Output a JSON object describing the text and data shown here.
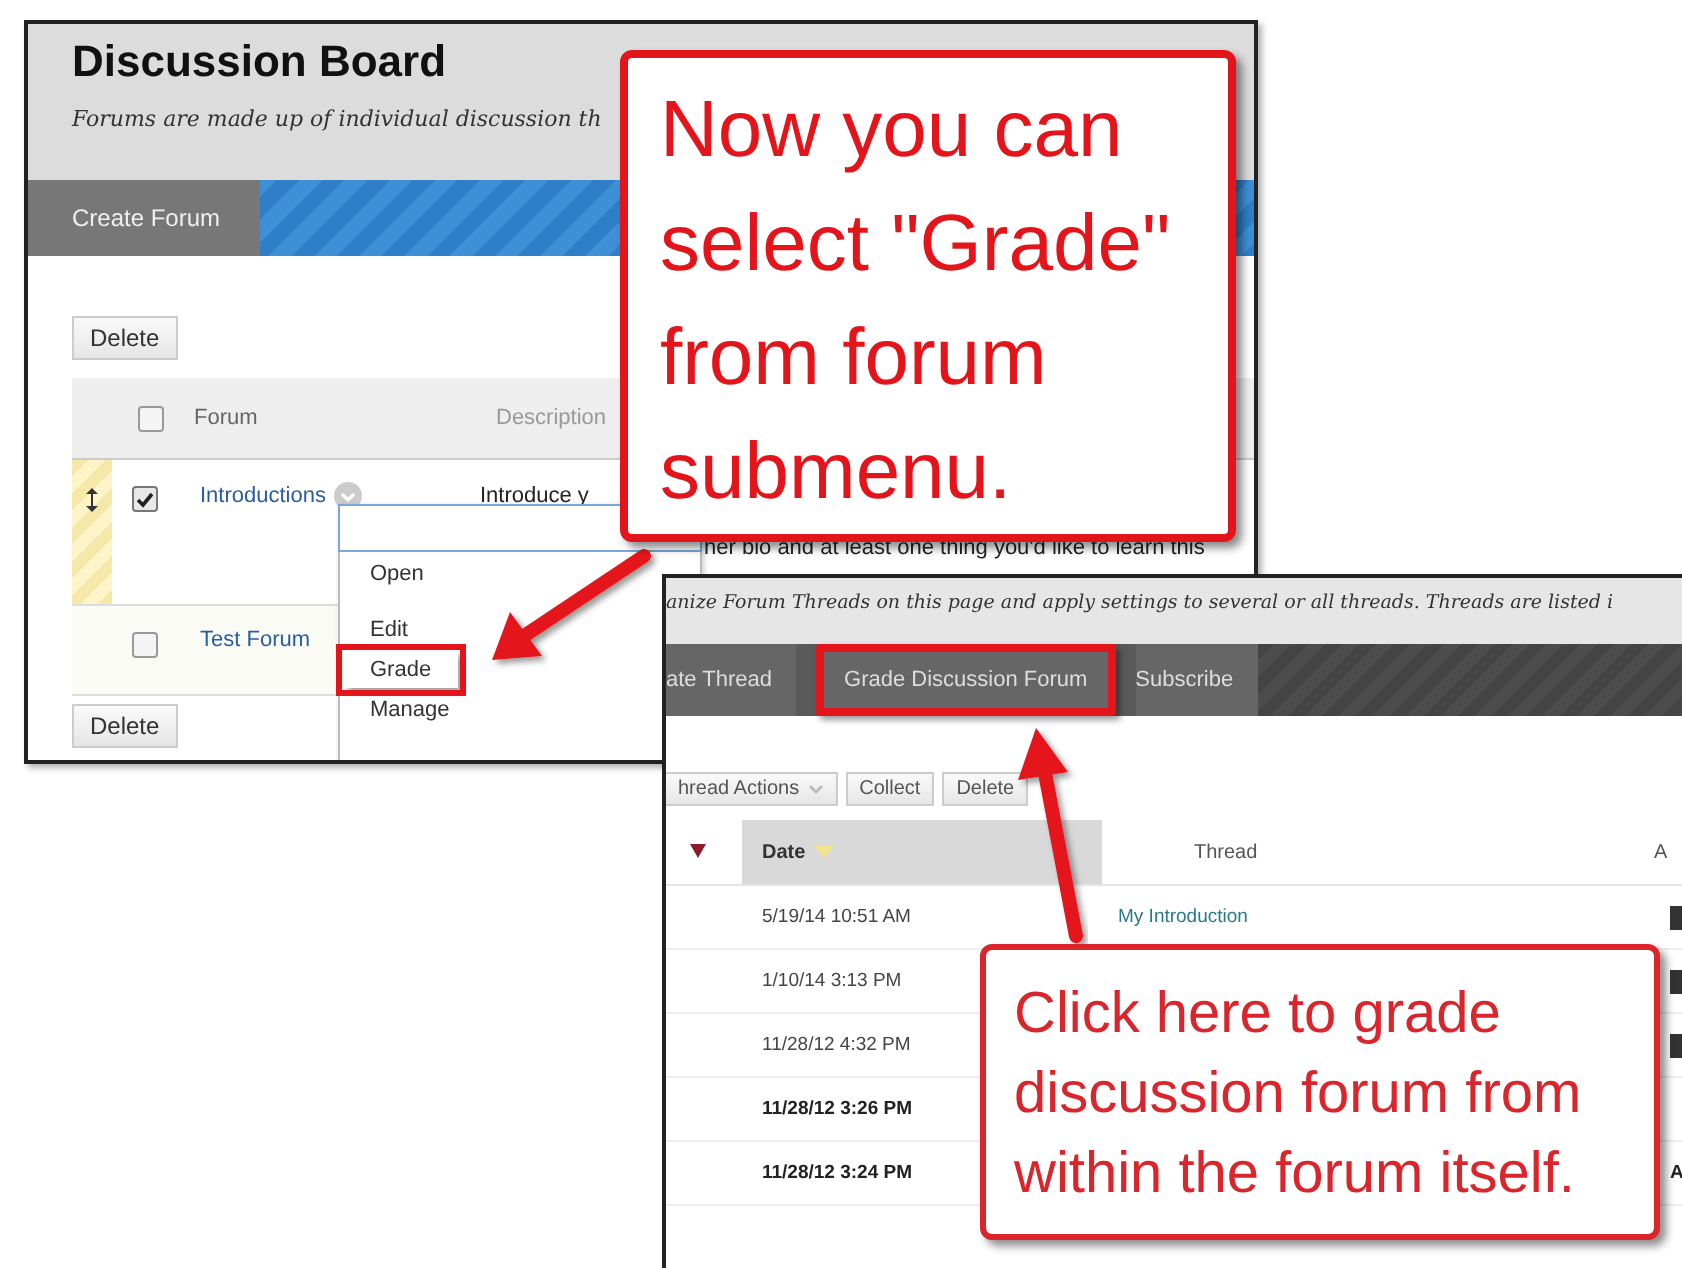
{
  "forums_page": {
    "title": "Discussion Board",
    "subtitle": "Forums are made up of individual discussion th",
    "toolbar": {
      "button": "Create Forum"
    },
    "delete_top": "Delete",
    "delete_bottom": "Delete",
    "select_all_checked": false,
    "columns": [
      "Forum",
      "Description"
    ],
    "rows": [
      {
        "name": "Introductions",
        "checked": true,
        "dragging": true,
        "description": "Introduce y",
        "detail": "her bio and at least one thing you'd like to learn this"
      },
      {
        "name": "Test Forum",
        "checked": false,
        "dragging": false,
        "description": "",
        "detail": ""
      }
    ],
    "menu": [
      {
        "label": "Open",
        "highlighted": false
      },
      {
        "label": "Edit",
        "highlighted": false
      },
      {
        "label": "Grade",
        "highlighted": true
      },
      {
        "label": "Manage",
        "highlighted": false
      }
    ]
  },
  "threads_page": {
    "subtitle": "anize Forum Threads on this page and apply settings to several or all threads. Threads are listed i",
    "tabs": [
      {
        "label": "ate Thread",
        "highlighted": false
      },
      {
        "label": "Grade Discussion Forum",
        "highlighted": true
      },
      {
        "label": "Subscribe",
        "highlighted": false
      }
    ],
    "actions": [
      "hread Actions",
      "Collect",
      "Delete"
    ],
    "columns": [
      "Date",
      "Thread",
      "A"
    ],
    "rows": [
      {
        "date": "5/19/14 10:51 AM",
        "thread": "My Introduction",
        "author": "",
        "avatar": true,
        "unread": false
      },
      {
        "date": "1/10/14 3:13 PM",
        "thread": "",
        "author": "",
        "avatar": true,
        "unread": false
      },
      {
        "date": "11/28/12 4:32 PM",
        "thread": "",
        "author": "",
        "avatar": true,
        "unread": false
      },
      {
        "date": "11/28/12 3:26 PM",
        "thread": "",
        "author": "",
        "avatar": false,
        "unread": true
      },
      {
        "date": "11/28/12 3:24 PM",
        "thread": "",
        "author": "A",
        "avatar": false,
        "unread": true
      }
    ]
  },
  "callouts": [
    {
      "text": "Now you can select \"Grade\" from forum submenu."
    },
    {
      "text": "Click here to grade discussion forum from within the forum itself."
    }
  ]
}
